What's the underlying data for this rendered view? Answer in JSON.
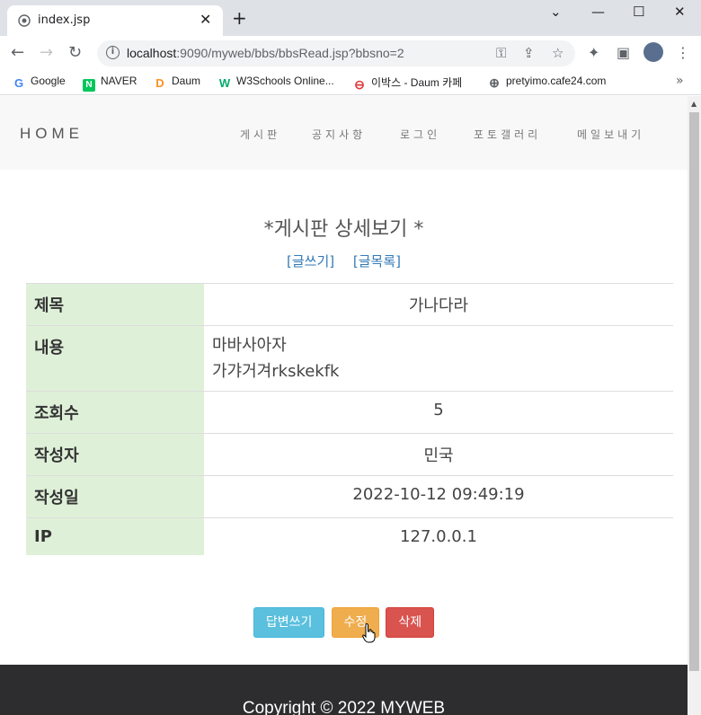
{
  "browser": {
    "tab_title": "index.jsp",
    "tab_close": "✕",
    "new_tab": "+",
    "url_host": "localhost",
    "url_rest": ":9090/myweb/bbs/bbsRead.jsp?bbsno=2",
    "window_controls": {
      "minimize": "—",
      "maximize": "☐",
      "close": "✕",
      "dropdown": "⌄"
    }
  },
  "bookmarks": [
    {
      "label": "Google",
      "icon": "google-icon",
      "color": "#4285f4",
      "glyph": "G"
    },
    {
      "label": "NAVER",
      "icon": "naver-icon",
      "color": "#03c75a",
      "glyph": "N"
    },
    {
      "label": "Daum",
      "icon": "daum-icon",
      "color": "#ff8f1f",
      "glyph": "D"
    },
    {
      "label": "W3Schools Online...",
      "icon": "w3schools-icon",
      "color": "#04aa6d",
      "glyph": "W"
    },
    {
      "label": "이박스 - Daum 카페",
      "icon": "daum-cafe-icon",
      "color": "#e03c3c",
      "glyph": "⊖"
    },
    {
      "label": "pretyimo.cafe24.com",
      "icon": "globe-icon",
      "color": "#5f6368",
      "glyph": "⊕"
    }
  ],
  "site": {
    "brand": "HOME",
    "nav": [
      "게시판",
      "공지사항",
      "로그인",
      "포토갤러리",
      "메일보내기"
    ],
    "page_title": "*게시판 상세보기 *",
    "links": {
      "write": "[글쓰기]",
      "list": "[글목록]"
    }
  },
  "post": {
    "rows": [
      {
        "label": "제목",
        "value": "가나다라"
      },
      {
        "label": "내용",
        "value_lines": [
          "마바사아자",
          "가갸거겨rkskekfk"
        ]
      },
      {
        "label": "조회수",
        "value": "5"
      },
      {
        "label": "작성자",
        "value": "민국"
      },
      {
        "label": "작성일",
        "value": "2022-10-12 09:49:19"
      },
      {
        "label": "IP",
        "value": "127.0.0.1"
      }
    ]
  },
  "buttons": {
    "reply": "답변쓰기",
    "edit": "수정",
    "delete": "삭제"
  },
  "footer": {
    "copyright": "Copyright © 2022 MYWEB"
  },
  "colors": {
    "label_bg": "#dff0d8",
    "info": "#5bc0de",
    "warning": "#f0ad4e",
    "danger": "#d9534f",
    "footer_bg": "#2d2d30",
    "link": "#337ab7"
  }
}
